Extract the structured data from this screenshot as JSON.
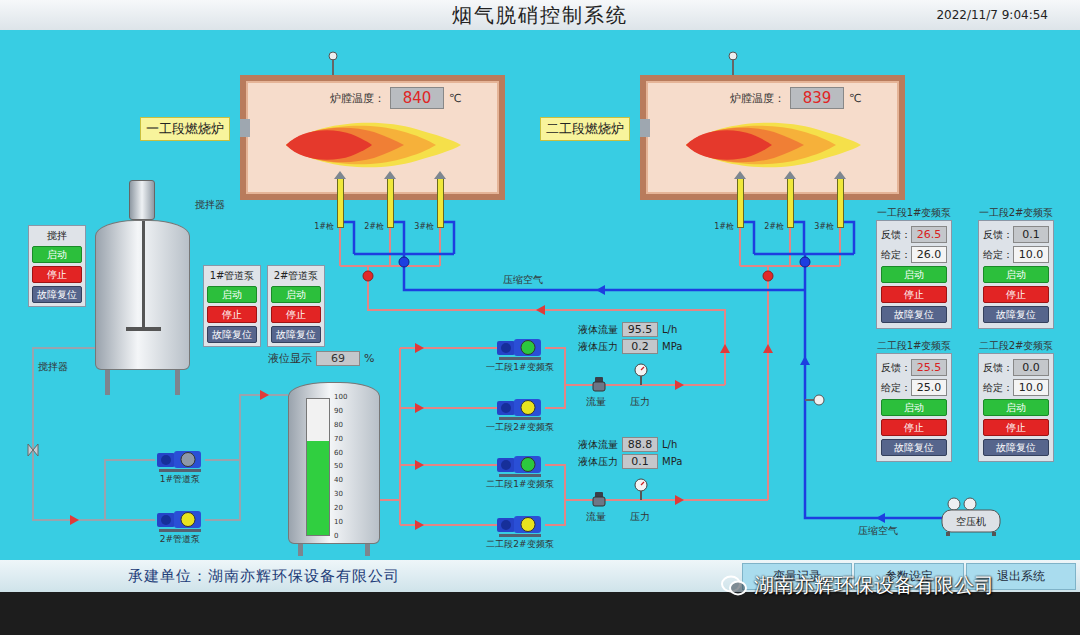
{
  "header": {
    "title": "烟气脱硝控制系统",
    "time": "2022/11/7 9:04:54"
  },
  "furnaces": [
    {
      "name": "一工段燃烧炉",
      "temp_label": "炉膛温度：",
      "temp": "840",
      "unit": "℃",
      "guns": [
        "1#枪",
        "2#枪",
        "3#枪"
      ]
    },
    {
      "name": "二工段燃烧炉",
      "temp_label": "炉膛温度：",
      "temp": "839",
      "unit": "℃",
      "guns": [
        "1#枪",
        "2#枪",
        "3#枪"
      ]
    }
  ],
  "mixer": {
    "tank_label": "搅拌器",
    "pipe_label": "搅拌器"
  },
  "control_boxes": [
    {
      "title": "搅拌",
      "buttons": [
        {
          "label": "启动",
          "kind": "start"
        },
        {
          "label": "停止",
          "kind": "stop"
        },
        {
          "label": "故障复位",
          "kind": "reset"
        }
      ]
    },
    {
      "title": "1#管道泵",
      "buttons": [
        {
          "label": "启动",
          "kind": "start"
        },
        {
          "label": "停止",
          "kind": "stop"
        },
        {
          "label": "故障复位",
          "kind": "reset"
        }
      ]
    },
    {
      "title": "2#管道泵",
      "buttons": [
        {
          "label": "启动",
          "kind": "start"
        },
        {
          "label": "停止",
          "kind": "stop"
        },
        {
          "label": "故障复位",
          "kind": "reset"
        }
      ]
    }
  ],
  "level_tank": {
    "label": "液位显示",
    "value": "69",
    "unit": "%",
    "level": 0.69,
    "ticks": [
      "100",
      "90",
      "80",
      "70",
      "60",
      "50",
      "40",
      "30",
      "20",
      "10",
      "0"
    ]
  },
  "pipe_pumps": [
    {
      "name": "1#管道泵",
      "color": "#8e98a8"
    },
    {
      "name": "2#管道泵",
      "color": "#e8e41e"
    }
  ],
  "vf_pumps": [
    {
      "name": "一工段1#变频泵",
      "color": "#2cc83e"
    },
    {
      "name": "一工段2#变频泵",
      "color": "#e8e41e"
    },
    {
      "name": "二工段1#变频泵",
      "color": "#2cc83e"
    },
    {
      "name": "二工段2#变频泵",
      "color": "#e8e41e"
    }
  ],
  "meters": [
    {
      "flow_label": "液体流量",
      "flow": "95.5",
      "flow_unit": "L/h",
      "pressure_label": "液体压力",
      "pressure": "0.2",
      "pressure_unit": "MPa",
      "flow_tag": "流量",
      "pressure_tag": "压力"
    },
    {
      "flow_label": "液体流量",
      "flow": "88.8",
      "flow_unit": "L/h",
      "pressure_label": "液体压力",
      "pressure": "0.1",
      "pressure_unit": "MPa",
      "flow_tag": "流量",
      "pressure_tag": "压力"
    }
  ],
  "air_labels": [
    "压缩空气",
    "压缩空气"
  ],
  "compressor": {
    "name": "空压机"
  },
  "vf_panels": [
    {
      "title": "一工段1#变频泵",
      "running": true,
      "feedback_label": "反馈：",
      "feedback": "26.5",
      "setpoint_label": "给定：",
      "setpoint": "26.0",
      "buttons": [
        {
          "label": "启动",
          "kind": "start"
        },
        {
          "label": "停止",
          "kind": "stop"
        },
        {
          "label": "故障复位",
          "kind": "reset"
        }
      ]
    },
    {
      "title": "一工段2#变频泵",
      "running": false,
      "feedback_label": "反馈：",
      "feedback": "0.1",
      "setpoint_label": "给定：",
      "setpoint": "10.0",
      "buttons": [
        {
          "label": "启动",
          "kind": "start"
        },
        {
          "label": "停止",
          "kind": "stop"
        },
        {
          "label": "故障复位",
          "kind": "reset"
        }
      ]
    },
    {
      "title": "二工段1#变频泵",
      "running": true,
      "feedback_label": "反馈：",
      "feedback": "25.5",
      "setpoint_label": "给定：",
      "setpoint": "25.0",
      "buttons": [
        {
          "label": "启动",
          "kind": "start"
        },
        {
          "label": "停止",
          "kind": "stop"
        },
        {
          "label": "故障复位",
          "kind": "reset"
        }
      ]
    },
    {
      "title": "二工段2#变频泵",
      "running": false,
      "feedback_label": "反馈：",
      "feedback": "0.0",
      "setpoint_label": "给定：",
      "setpoint": "10.0",
      "buttons": [
        {
          "label": "启动",
          "kind": "start"
        },
        {
          "label": "停止",
          "kind": "stop"
        },
        {
          "label": "故障复位",
          "kind": "reset"
        }
      ]
    }
  ],
  "footer": {
    "builder": "承建单位：湖南亦辉环保设备有限公司",
    "buttons": [
      "变量记录",
      "参数设定",
      "退出系统"
    ]
  },
  "watermark": {
    "text": "湖南亦辉环保设备有限公司"
  }
}
